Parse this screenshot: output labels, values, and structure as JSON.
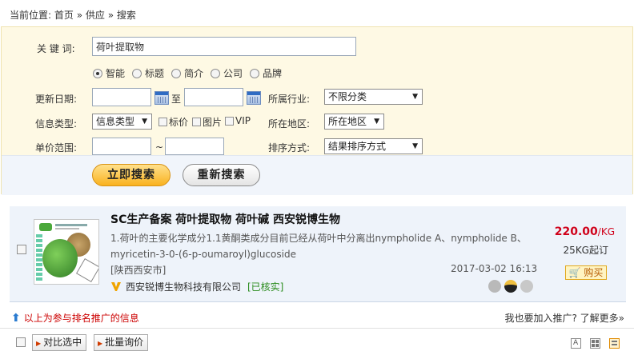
{
  "breadcrumb": {
    "prefix": "当前位置: ",
    "home": "首页",
    "sep1": " » ",
    "supply": "供应",
    "sep2": " » ",
    "current": "搜索"
  },
  "search": {
    "keyword_label": "关 键 词:",
    "keyword_value": "荷叶提取物",
    "scope_options": [
      "智能",
      "标题",
      "简介",
      "公司",
      "品牌"
    ],
    "scope_selected": "智能",
    "update_date_label": "更新日期:",
    "date_to": "至",
    "industry_label": "所属行业:",
    "industry_value": "不限分类",
    "info_type_label": "信息类型:",
    "info_type_value": "信息类型",
    "chk_price": "标价",
    "chk_image": "图片",
    "chk_vip": "VIP",
    "region_label": "所在地区:",
    "region_value": "所在地区",
    "price_range_label": "单价范围:",
    "price_sep": "~",
    "sort_label": "排序方式:",
    "sort_value": "结果排序方式",
    "search_button": "立即搜索",
    "reset_button": "重新搜索"
  },
  "result": {
    "title": "SC生产备案 荷叶提取物 荷叶碱 西安锐博生物",
    "description": "1.荷叶的主要化学成分1.1黄酮类成分目前已经从荷叶中分离出nympholide A、nympholide B、myricetin-3-0-(6-p-oumaroyl)glucoside",
    "location": "[陕西西安市]",
    "date": "2017-03-02 16:13",
    "company": "西安锐博生物科技有限公司",
    "verified": "[已核实]",
    "price": "220.00",
    "price_unit": "/KG",
    "min_order": "25KG起订",
    "buy_label": "购买"
  },
  "promo_note": "以上为参与排名推广的信息",
  "join_note": "我也要加入推广? 了解更多»",
  "footer": {
    "compare_button": "对比选中",
    "inquiry_button": "批量询价"
  },
  "colors": {
    "price_red": "#d0021b",
    "verified_green": "#2b8c1e",
    "search_bg": "#fef9e4",
    "primary_button": "#f9b21f"
  }
}
